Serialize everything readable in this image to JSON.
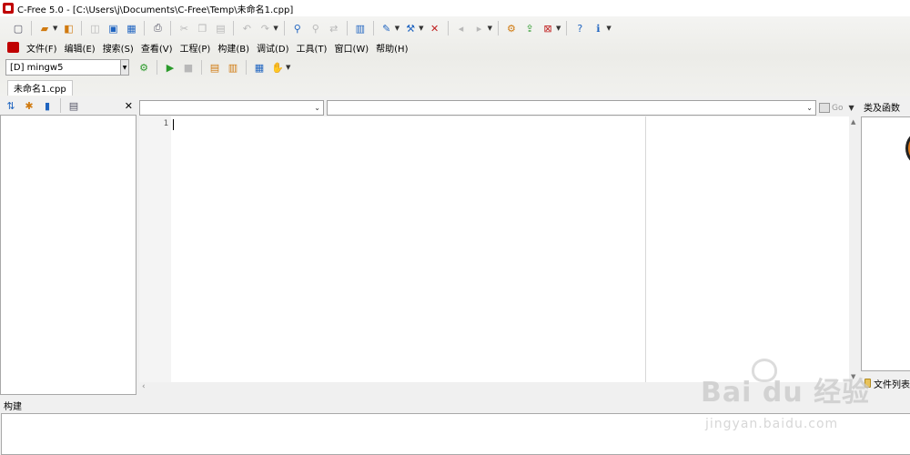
{
  "window": {
    "title": "C-Free 5.0 - [C:\\Users\\j\\Documents\\C-Free\\Temp\\未命名1.cpp]"
  },
  "menu": {
    "items": [
      "文件(F)",
      "编辑(E)",
      "搜索(S)",
      "查看(V)",
      "工程(P)",
      "构建(B)",
      "调试(D)",
      "工具(T)",
      "窗口(W)",
      "帮助(H)"
    ]
  },
  "compiler": {
    "selected": "[D] mingw5"
  },
  "tabs": [
    {
      "label": "未命名1.cpp"
    }
  ],
  "editor": {
    "line_numbers": [
      "1"
    ],
    "go_label": "Go"
  },
  "right_panel": {
    "title": "类及函数",
    "tab_label": "文件列表"
  },
  "build_panel": {
    "title": "构建"
  },
  "watermark": {
    "brand": "Bai du 经验",
    "url": "jingyan.baidu.com"
  },
  "colors": {
    "app_red": "#c00000",
    "accent_blue": "#1f64c0",
    "run_green": "#2a9a2a"
  }
}
